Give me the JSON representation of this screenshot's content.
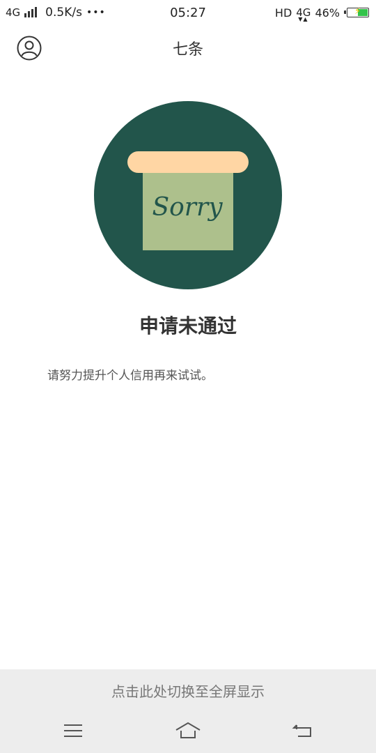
{
  "status_bar": {
    "network_left": "4G",
    "speed": "0.5K/s",
    "more": "•••",
    "time": "05:27",
    "hd": "HD",
    "network_right": "4G",
    "battery": "46%"
  },
  "header": {
    "title": "七条"
  },
  "illustration": {
    "text": "Sorry",
    "colors": {
      "circle": "#22554b",
      "bar": "#ffd6a4",
      "card": "#adc08c",
      "text": "#22554b"
    }
  },
  "result": {
    "title": "申请未通过",
    "description": "请努力提升个人信用再来试试。"
  },
  "fullscreen_prompt": "点击此处切换至全屏显示",
  "nav_bar": {
    "icons": [
      "menu-icon",
      "home-icon",
      "back-icon"
    ]
  }
}
